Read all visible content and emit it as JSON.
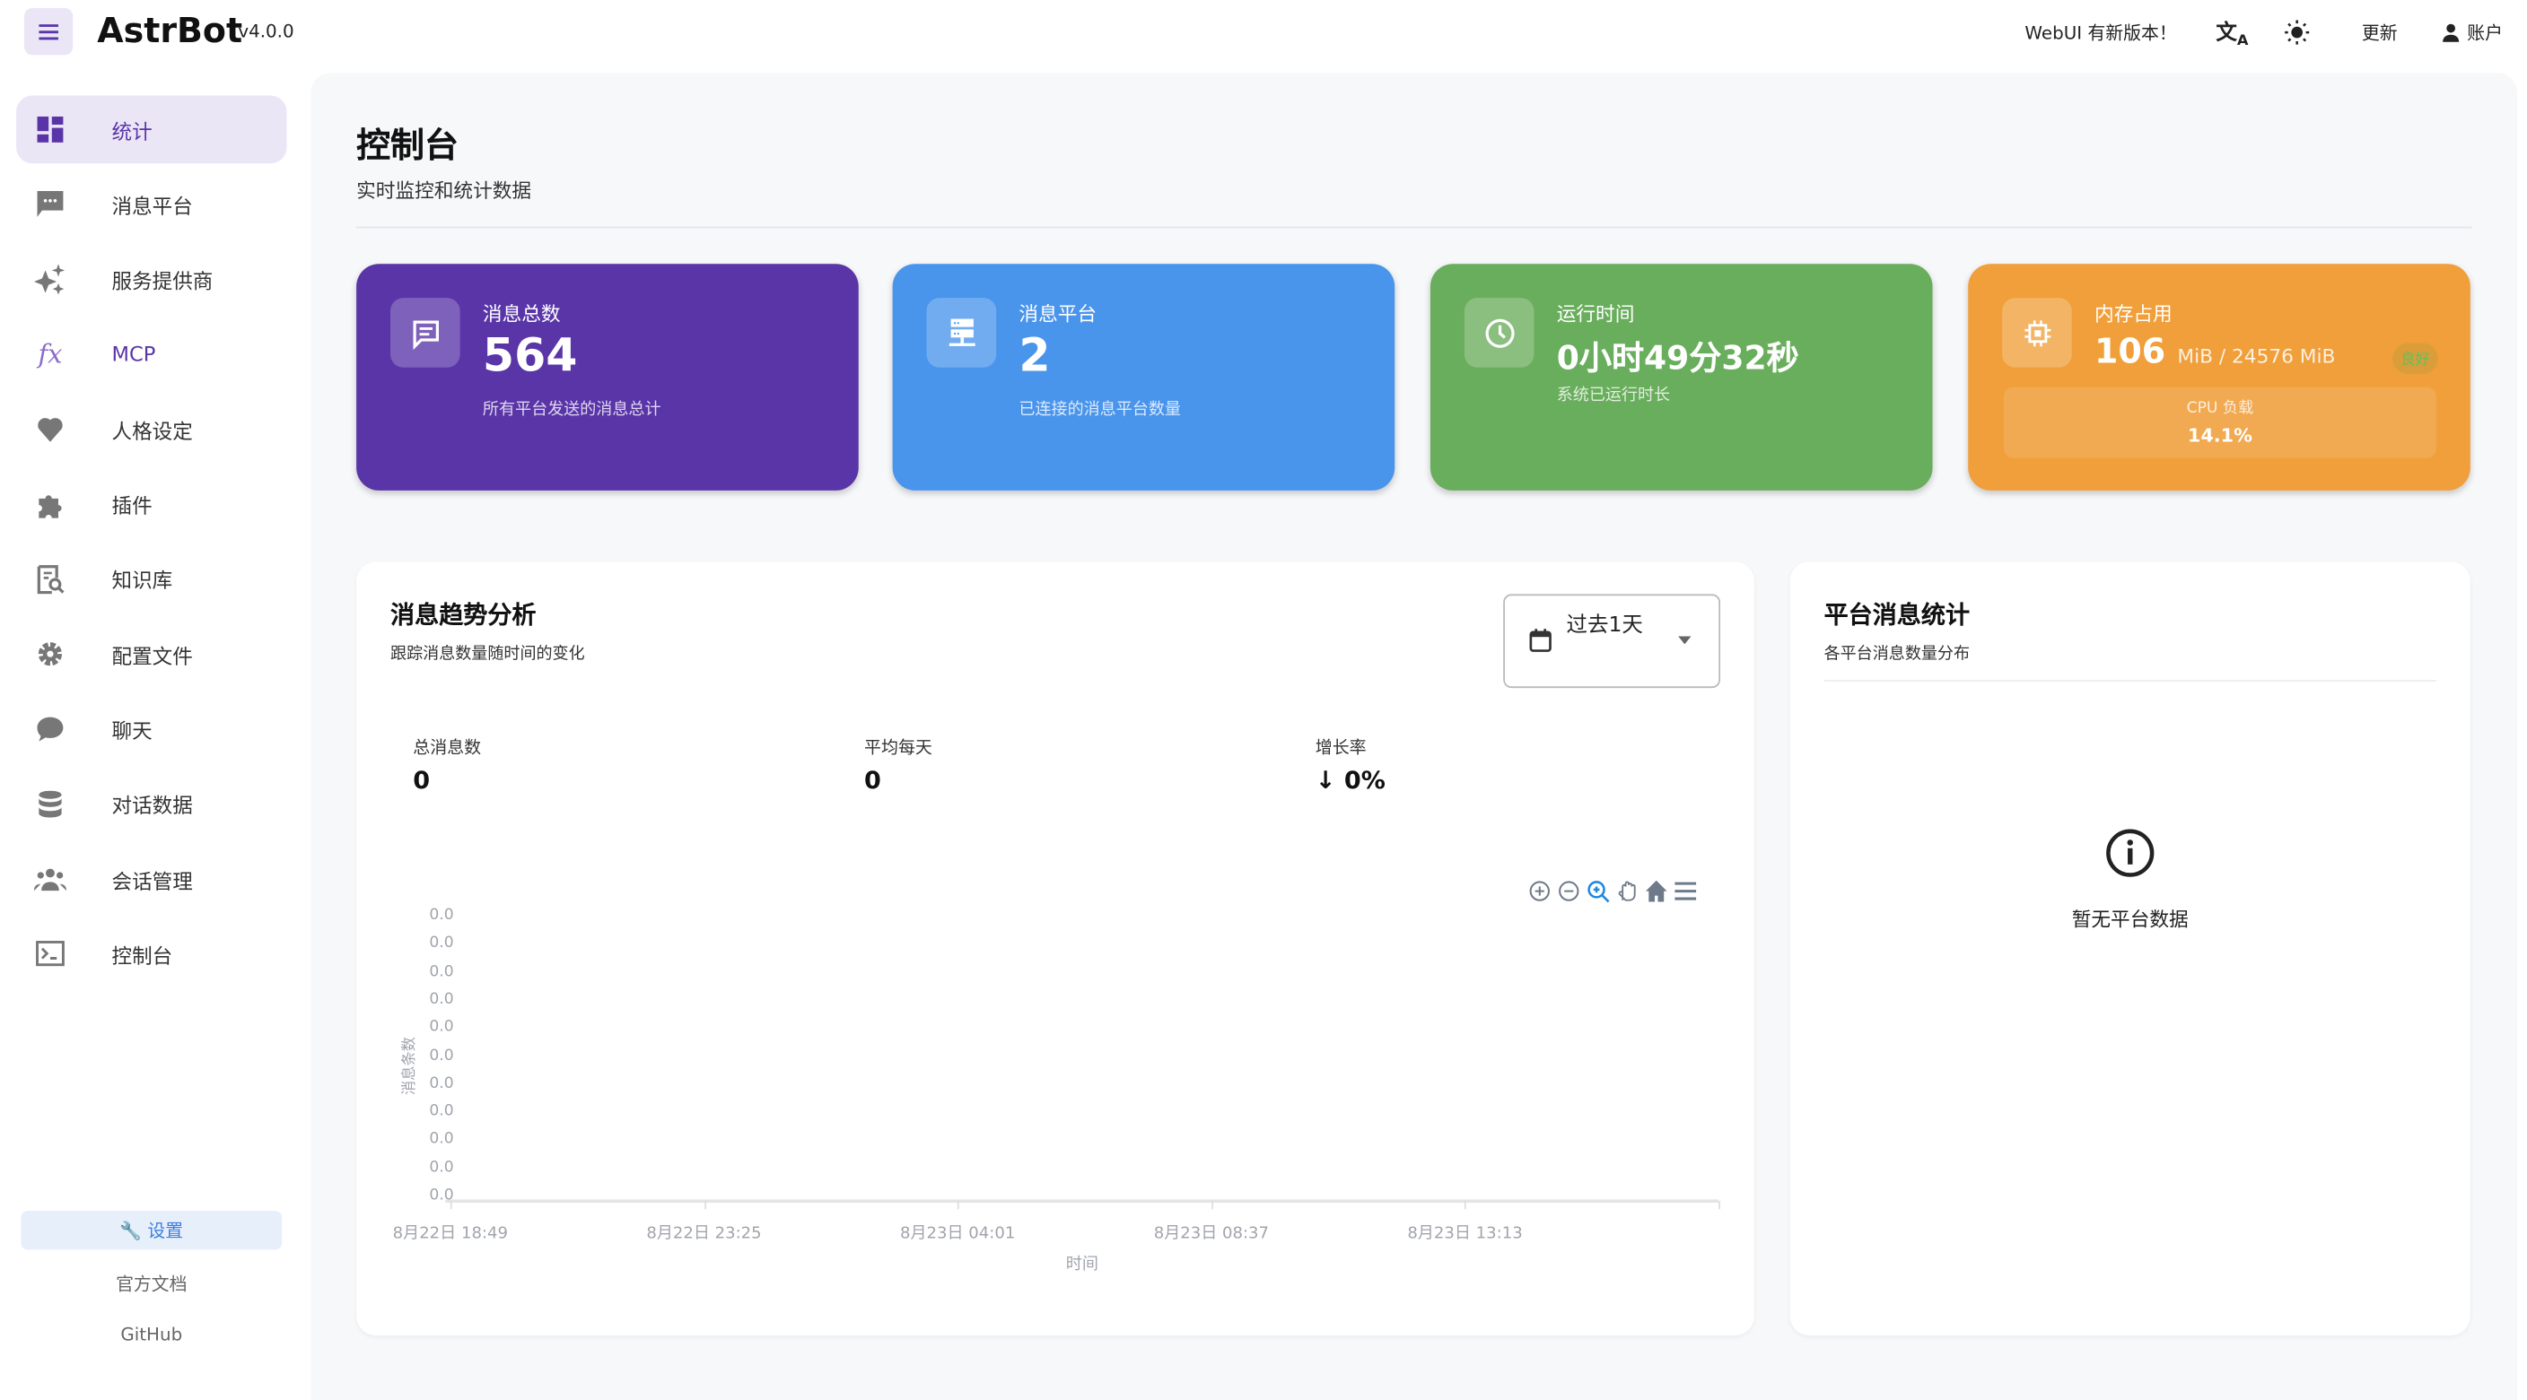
{
  "header": {
    "app_name": "AstrBot",
    "version": "v4.0.0",
    "update_notice": "WebUI 有新版本！",
    "language_icon": "translate-icon",
    "theme_icon": "sun-icon",
    "update_label": "更新",
    "account_label": "账户"
  },
  "sidebar": {
    "items": [
      {
        "label": "统计",
        "icon": "dashboard-icon",
        "active": true
      },
      {
        "label": "消息平台",
        "icon": "message-icon"
      },
      {
        "label": "服务提供商",
        "icon": "sparkle-icon"
      },
      {
        "label": "MCP",
        "icon": "function-icon"
      },
      {
        "label": "人格设定",
        "icon": "heart-icon"
      },
      {
        "label": "插件",
        "icon": "puzzle-icon"
      },
      {
        "label": "知识库",
        "icon": "book-search-icon"
      },
      {
        "label": "配置文件",
        "icon": "gear-icon"
      },
      {
        "label": "聊天",
        "icon": "chat-icon"
      },
      {
        "label": "对话数据",
        "icon": "database-icon"
      },
      {
        "label": "会话管理",
        "icon": "users-icon"
      },
      {
        "label": "控制台",
        "icon": "terminal-icon"
      }
    ],
    "settings_label": "🔧 设置",
    "docs_label": "官方文档",
    "github_label": "GitHub"
  },
  "page": {
    "title": "控制台",
    "subtitle": "实时监控和统计数据"
  },
  "cards": {
    "messages": {
      "label": "消息总数",
      "value": "564",
      "sub": "所有平台发送的消息总计",
      "color": "#5a35a8"
    },
    "platforms": {
      "label": "消息平台",
      "value": "2",
      "sub": "已连接的消息平台数量",
      "color": "#4a95ec"
    },
    "uptime": {
      "label": "运行时间",
      "value": "0小时49分32秒",
      "sub": "系统已运行时长",
      "color": "#69ae5c"
    },
    "memory": {
      "label": "内存占用",
      "value": "106",
      "unit": "MiB / 24576 MiB",
      "status": "良好",
      "cpu_label": "CPU 负载",
      "cpu_value": "14.1%",
      "color": "#f09f3a"
    }
  },
  "trend": {
    "title": "消息趋势分析",
    "subtitle": "跟踪消息数量随时间的变化",
    "range_select": "过去1天",
    "stats": [
      {
        "label": "总消息数",
        "value": "0"
      },
      {
        "label": "平均每天",
        "value": "0"
      },
      {
        "label": "增长率",
        "value": "↓ 0%"
      }
    ]
  },
  "platform_stats": {
    "title": "平台消息统计",
    "subtitle": "各平台消息数量分布",
    "empty_text": "暂无平台数据"
  },
  "chart_data": {
    "type": "line",
    "title": "",
    "xlabel": "时间",
    "ylabel": "消息条数",
    "x_tick_labels": [
      "8月22日 18:49",
      "8月22日 23:25",
      "8月23日 04:01",
      "8月23日 08:37",
      "8月23日 13:13"
    ],
    "y_tick_labels": [
      "0.0",
      "0.0",
      "0.0",
      "0.0",
      "0.0",
      "0.0",
      "0.0",
      "0.0",
      "0.0",
      "0.0",
      "0.0"
    ],
    "series": [],
    "toolbar": [
      "zoom-in-icon",
      "zoom-out-icon",
      "selection-zoom-icon",
      "pan-icon",
      "reset-home-icon",
      "menu-icon"
    ]
  }
}
